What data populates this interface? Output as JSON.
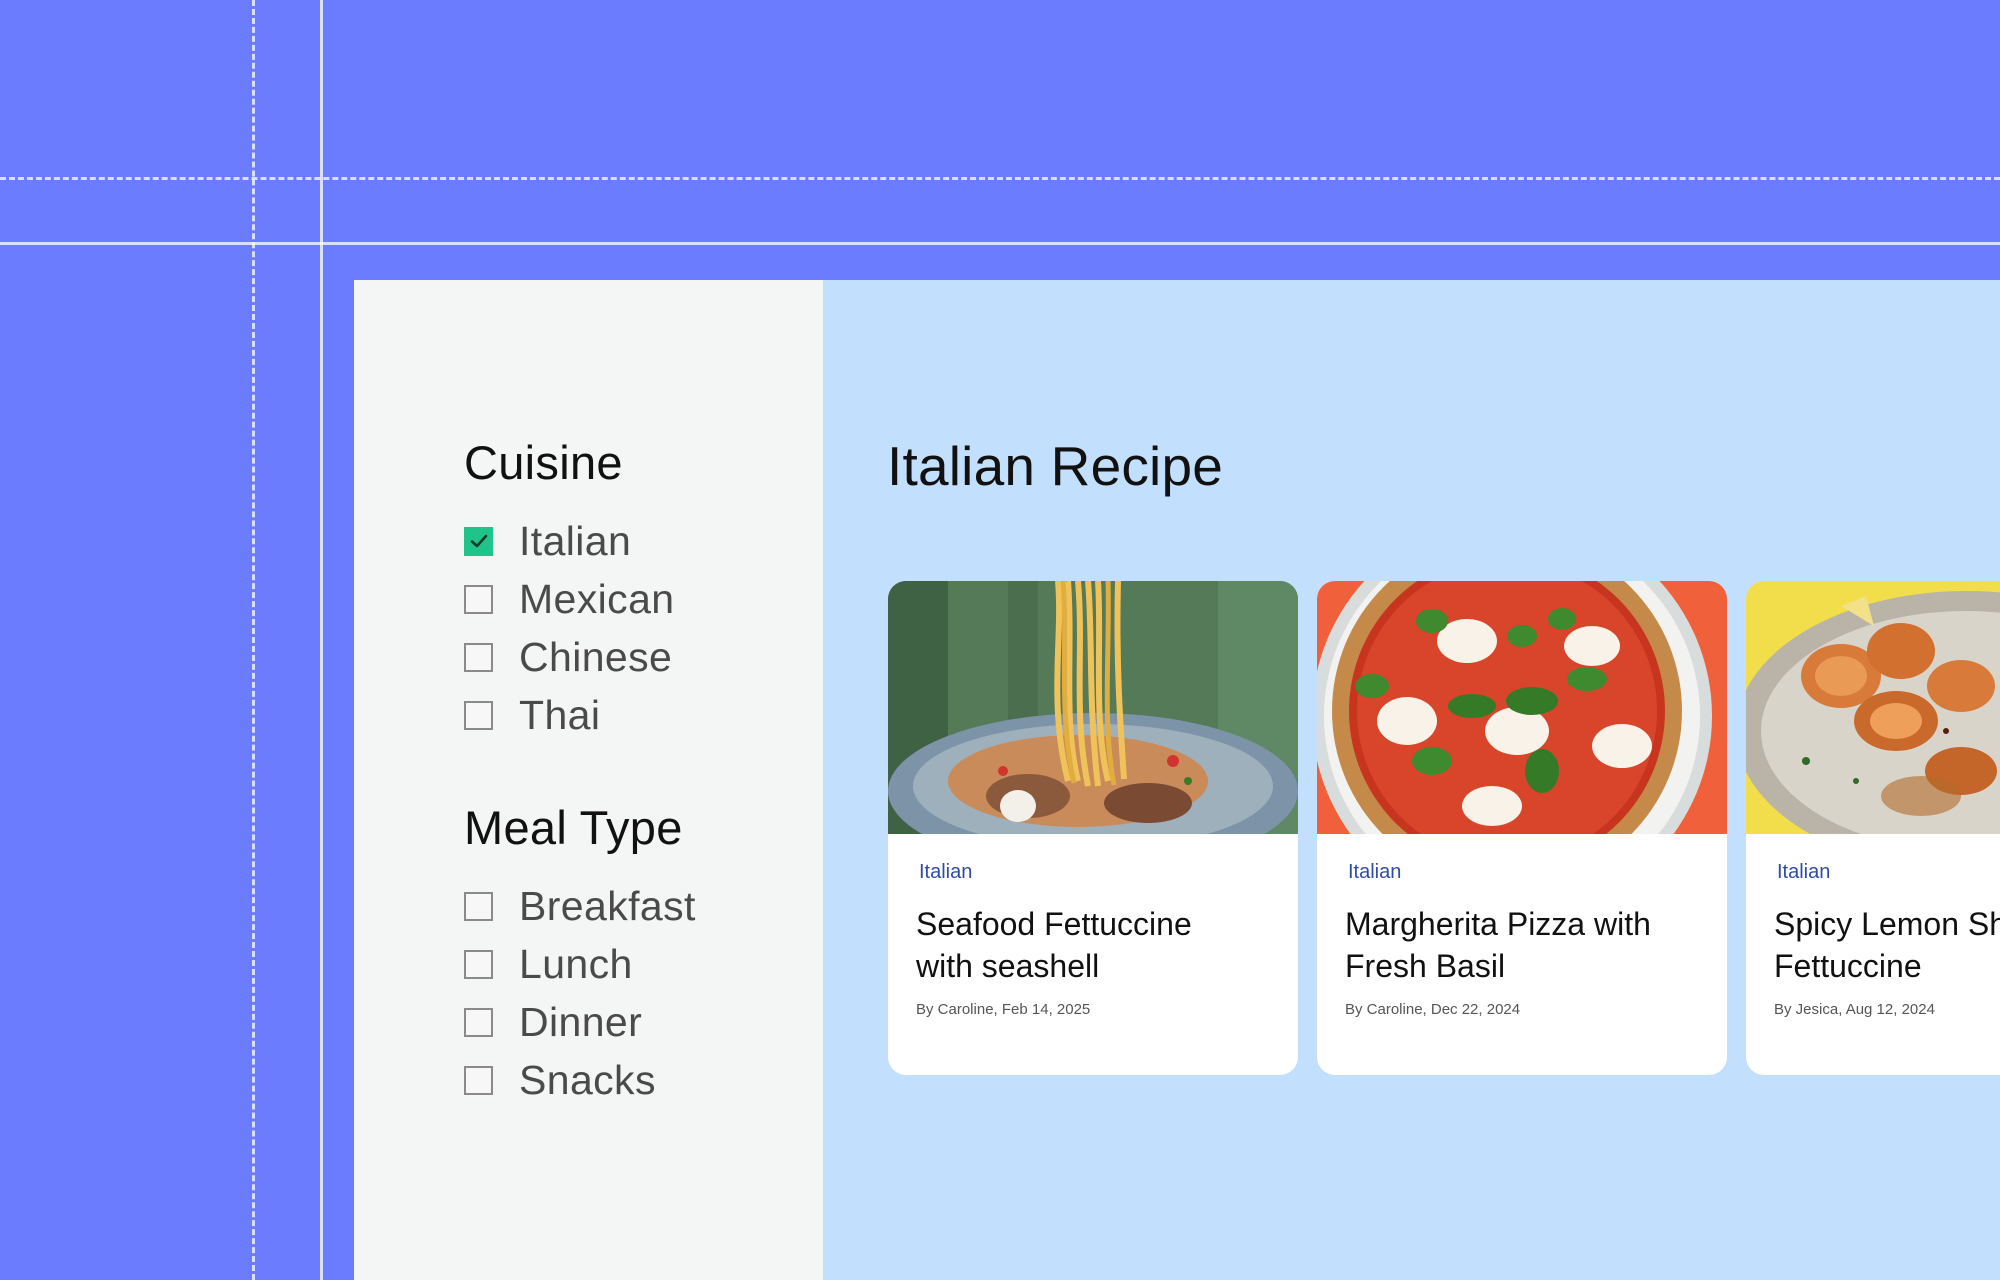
{
  "colors": {
    "canvas_background": "#6c7cff",
    "sidebar_background": "#f4f5f5",
    "main_background": "#c2dffd",
    "checkbox_checked": "#1fc48a",
    "tag_color": "#2f4ba8"
  },
  "sidebar": {
    "groups": [
      {
        "title": "Cuisine",
        "options": [
          {
            "label": "Italian",
            "checked": true
          },
          {
            "label": "Mexican",
            "checked": false
          },
          {
            "label": "Chinese",
            "checked": false
          },
          {
            "label": "Thai",
            "checked": false
          }
        ]
      },
      {
        "title": "Meal Type",
        "options": [
          {
            "label": "Breakfast",
            "checked": false
          },
          {
            "label": "Lunch",
            "checked": false
          },
          {
            "label": "Dinner",
            "checked": false
          },
          {
            "label": "Snacks",
            "checked": false
          }
        ]
      }
    ]
  },
  "main": {
    "title": "Italian Recipe",
    "cards": [
      {
        "image_icon": "seafood-pasta-image",
        "tag": "Italian",
        "title_line1": "Seafood Fettuccine",
        "title_line2": "with seashell",
        "meta": "By Caroline, Feb 14, 2025"
      },
      {
        "image_icon": "pizza-image",
        "tag": "Italian",
        "title_line1": "Margherita Pizza with",
        "title_line2": "Fresh Basil",
        "meta": "By Caroline, Dec 22, 2024"
      },
      {
        "image_icon": "shrimp-image",
        "tag": "Italian",
        "title_line1": "Spicy Lemon Shrimp",
        "title_line2": "Fettuccine",
        "meta": "By Jesica, Aug 12, 2024"
      }
    ]
  }
}
